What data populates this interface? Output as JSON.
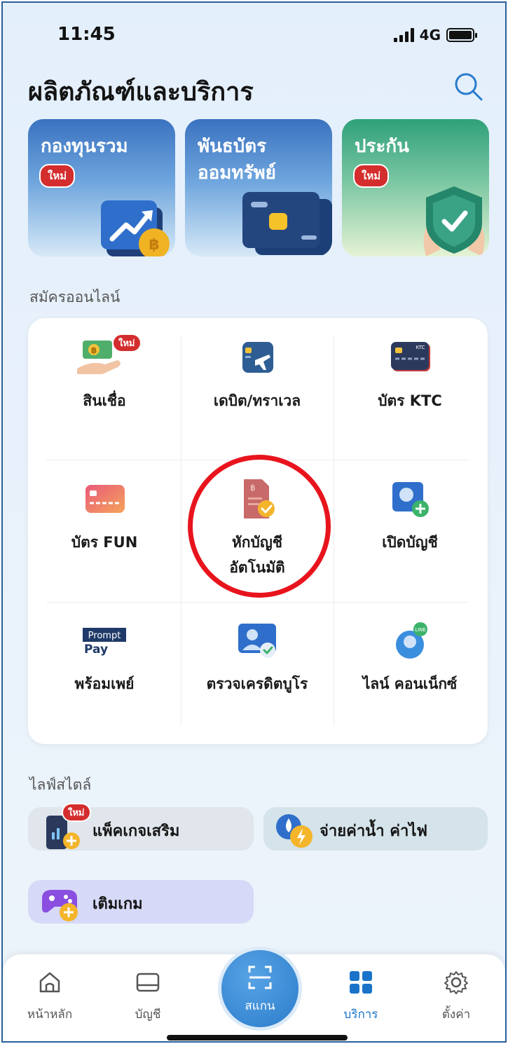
{
  "status_bar": {
    "time": "11:45",
    "network": "4G"
  },
  "header": {
    "title": "ผลิตภัณฑ์และบริการ"
  },
  "products": [
    {
      "title_line1": "กองทุนรวม",
      "title_line2": "",
      "badge": "ใหม่"
    },
    {
      "title_line1": "พันธบัตร",
      "title_line2": "ออมทรัพย์",
      "badge": ""
    },
    {
      "title_line1": "ประกัน",
      "title_line2": "",
      "badge": "ใหม่"
    }
  ],
  "sections": {
    "apply_online": "สมัครออนไลน์",
    "lifestyle": "ไลฟ์สไตล์"
  },
  "services": [
    {
      "label_line1": "สินเชื่อ",
      "label_line2": "",
      "badge": "ใหม่"
    },
    {
      "label_line1": "เดบิต/ทราเวล",
      "label_line2": ""
    },
    {
      "label_line1": "บัตร KTC",
      "label_line2": "",
      "icon_text": "KTC"
    },
    {
      "label_line1": "บัตร FUN",
      "label_line2": ""
    },
    {
      "label_line1": "หักบัญชี",
      "label_line2": "อัตโนมัติ"
    },
    {
      "label_line1": "เปิดบัญชี",
      "label_line2": ""
    },
    {
      "label_line1": "พร้อมเพย์",
      "label_line2": "",
      "icon_text_1": "Prompt",
      "icon_text_2": "Pay"
    },
    {
      "label_line1": "ตรวจเครดิตบูโร",
      "label_line2": ""
    },
    {
      "label_line1": "ไลน์ คอนเน็กซ์",
      "label_line2": "",
      "icon_text": "LINE"
    }
  ],
  "lifestyle": [
    {
      "label": "แพ็คเกจเสริม",
      "badge": "ใหม่"
    },
    {
      "label": "จ่ายค่าน้ำ ค่าไฟ"
    },
    {
      "label": "เติมเกม"
    }
  ],
  "tabs": [
    {
      "label": "หน้าหลัก"
    },
    {
      "label": "บัญชี"
    },
    {
      "label": "สแกน"
    },
    {
      "label": "บริการ"
    },
    {
      "label": "ตั้งค่า"
    }
  ],
  "colors": {
    "accent": "#1a73c8",
    "badge": "#d42d2d",
    "highlight": "#e8141d"
  }
}
